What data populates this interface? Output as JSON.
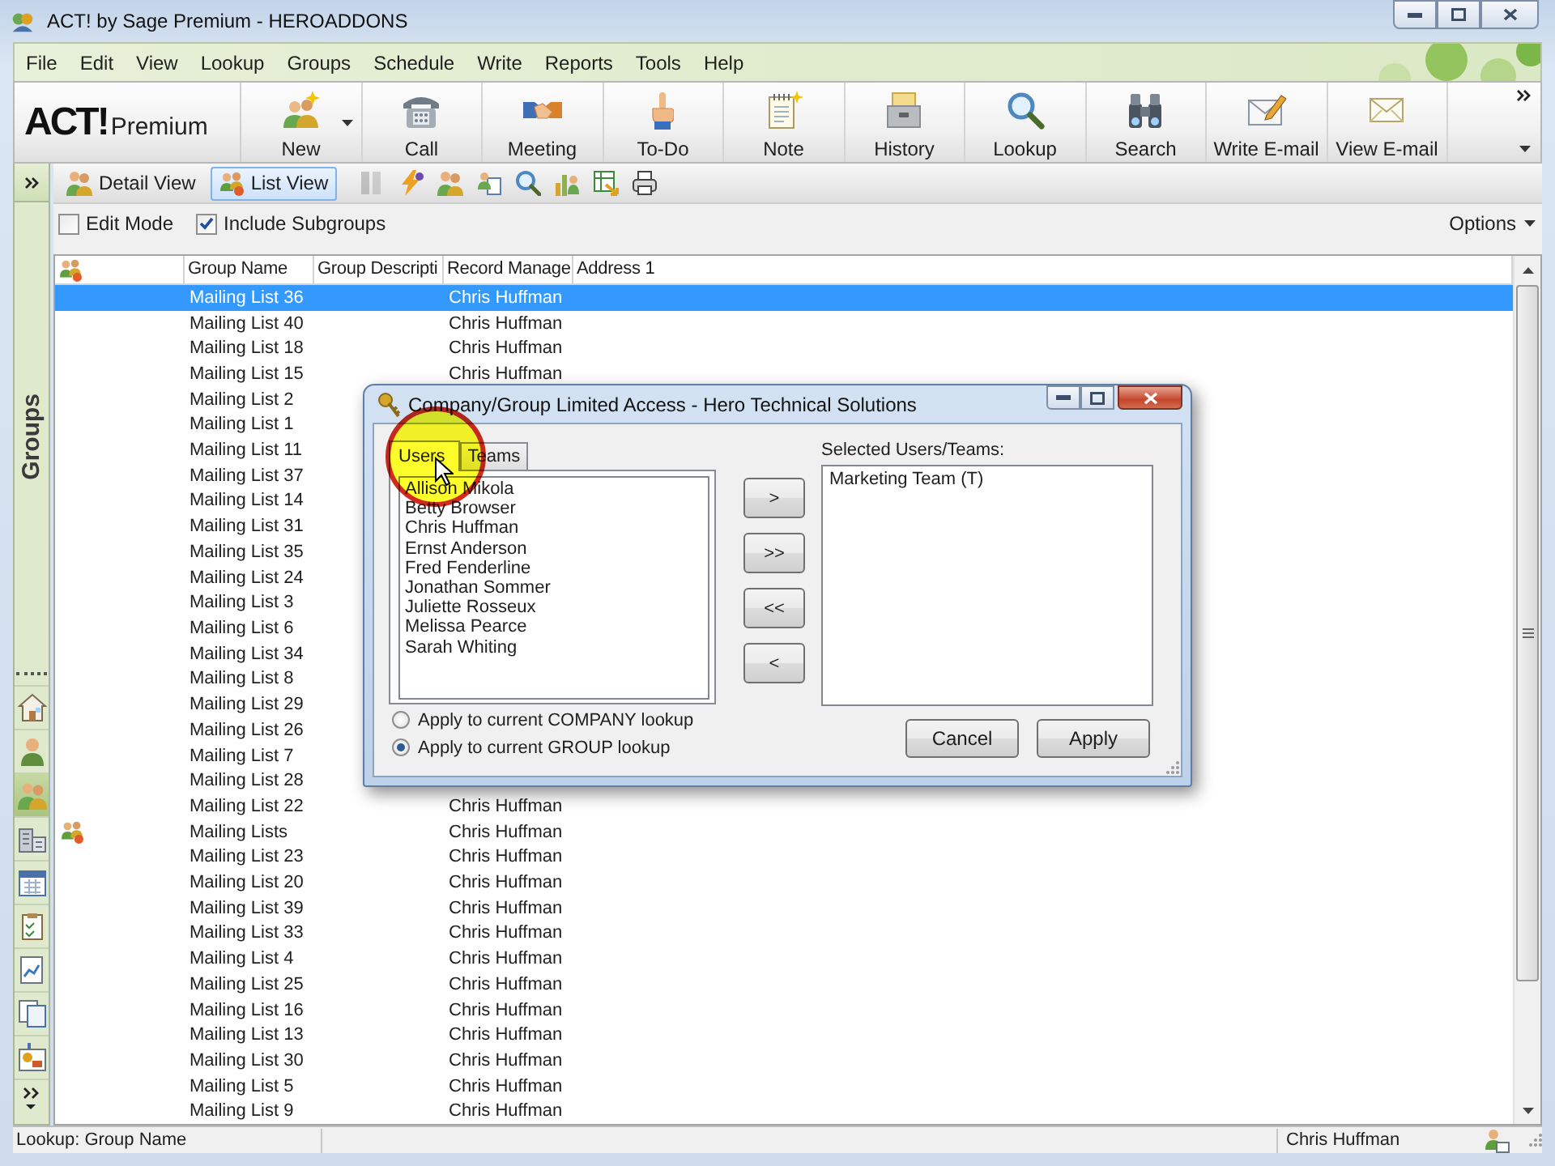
{
  "window": {
    "title": "ACT! by Sage Premium - HEROADDONS"
  },
  "menu": [
    "File",
    "Edit",
    "View",
    "Lookup",
    "Groups",
    "Schedule",
    "Write",
    "Reports",
    "Tools",
    "Help"
  ],
  "toolbar": {
    "logo": {
      "brand": "ACT!",
      "edition": "Premium"
    },
    "buttons": [
      {
        "label": "New",
        "dropdown": true
      },
      {
        "label": "Call",
        "dropdown": false
      },
      {
        "label": "Meeting",
        "dropdown": false
      },
      {
        "label": "To-Do",
        "dropdown": false
      },
      {
        "label": "Note",
        "dropdown": false
      },
      {
        "label": "History",
        "dropdown": false
      },
      {
        "label": "Lookup",
        "dropdown": false
      },
      {
        "label": "Search",
        "dropdown": false
      },
      {
        "label": "Write E-mail",
        "dropdown": false
      },
      {
        "label": "View E-mail",
        "dropdown": false
      }
    ]
  },
  "view_toolbar": {
    "views": [
      {
        "label": "Detail View",
        "selected": false
      },
      {
        "label": "List View",
        "selected": true
      }
    ],
    "tools": [
      {
        "disabled": true
      },
      {
        "disabled": false
      },
      {
        "disabled": false
      },
      {
        "disabled": false
      },
      {
        "disabled": false
      },
      {
        "disabled": false
      },
      {
        "disabled": false
      },
      {
        "disabled": false
      }
    ]
  },
  "options_bar": {
    "checkboxes": [
      {
        "label": "Edit Mode",
        "checked": false
      },
      {
        "label": "Include Subgroups",
        "checked": true
      }
    ],
    "options": "Options"
  },
  "sidebar": {
    "title": "Groups",
    "items": [
      {
        "selected": false
      },
      {
        "selected": false
      },
      {
        "selected": true
      },
      {
        "selected": false
      },
      {
        "selected": false
      },
      {
        "selected": false
      },
      {
        "selected": false
      },
      {
        "selected": false
      },
      {
        "selected": false
      }
    ]
  },
  "table": {
    "columns": [
      "Group Name",
      "Group Descripti",
      "Record Manage",
      "Address 1"
    ],
    "rows": [
      {
        "group_name": "Mailing List 36",
        "record_manager": "Chris Huffman",
        "kind": "list",
        "selected": true
      },
      {
        "group_name": "Mailing List 40",
        "record_manager": "Chris Huffman",
        "kind": "list",
        "selected": false
      },
      {
        "group_name": "Mailing List 18",
        "record_manager": "Chris Huffman",
        "kind": "list",
        "selected": false
      },
      {
        "group_name": "Mailing List 15",
        "record_manager": "Chris Huffman",
        "kind": "list",
        "selected": false
      },
      {
        "group_name": "Mailing List 2",
        "kind": "list",
        "selected": false
      },
      {
        "group_name": "Mailing List 1",
        "kind": "list",
        "selected": false
      },
      {
        "group_name": "Mailing List 11",
        "kind": "list",
        "selected": false
      },
      {
        "group_name": "Mailing List 37",
        "kind": "list",
        "selected": false
      },
      {
        "group_name": "Mailing List 14",
        "kind": "list",
        "selected": false
      },
      {
        "group_name": "Mailing List 31",
        "kind": "list",
        "selected": false
      },
      {
        "group_name": "Mailing List 35",
        "kind": "list",
        "selected": false
      },
      {
        "group_name": "Mailing List 24",
        "kind": "list",
        "selected": false
      },
      {
        "group_name": "Mailing List 3",
        "kind": "list",
        "selected": false
      },
      {
        "group_name": "Mailing List 6",
        "kind": "list",
        "selected": false
      },
      {
        "group_name": "Mailing List 34",
        "kind": "list",
        "selected": false
      },
      {
        "group_name": "Mailing List 8",
        "kind": "list",
        "selected": false
      },
      {
        "group_name": "Mailing List 29",
        "kind": "list",
        "selected": false
      },
      {
        "group_name": "Mailing List 26",
        "kind": "list",
        "selected": false
      },
      {
        "group_name": "Mailing List 7",
        "kind": "list",
        "selected": false
      },
      {
        "group_name": "Mailing List 28",
        "kind": "list",
        "selected": false
      },
      {
        "group_name": "Mailing List 22",
        "record_manager": "Chris Huffman",
        "kind": "list",
        "selected": false
      },
      {
        "group_name": "Mailing Lists",
        "record_manager": "Chris Huffman",
        "kind": "parent",
        "selected": false
      },
      {
        "group_name": "Mailing List 23",
        "record_manager": "Chris Huffman",
        "kind": "list",
        "selected": false
      },
      {
        "group_name": "Mailing List 20",
        "record_manager": "Chris Huffman",
        "kind": "list",
        "selected": false
      },
      {
        "group_name": "Mailing List 39",
        "record_manager": "Chris Huffman",
        "kind": "list",
        "selected": false
      },
      {
        "group_name": "Mailing List 33",
        "record_manager": "Chris Huffman",
        "kind": "list",
        "selected": false
      },
      {
        "group_name": "Mailing List 4",
        "record_manager": "Chris Huffman",
        "kind": "list",
        "selected": false
      },
      {
        "group_name": "Mailing List 25",
        "record_manager": "Chris Huffman",
        "kind": "list",
        "selected": false
      },
      {
        "group_name": "Mailing List 16",
        "record_manager": "Chris Huffman",
        "kind": "list",
        "selected": false
      },
      {
        "group_name": "Mailing List 13",
        "record_manager": "Chris Huffman",
        "kind": "list",
        "selected": false
      },
      {
        "group_name": "Mailing List 30",
        "record_manager": "Chris Huffman",
        "kind": "list",
        "selected": false
      },
      {
        "group_name": "Mailing List 5",
        "record_manager": "Chris Huffman",
        "kind": "list",
        "selected": false
      },
      {
        "group_name": "Mailing List 9",
        "record_manager": "Chris Huffman",
        "kind": "list",
        "selected": false
      }
    ]
  },
  "dialog": {
    "title": "Company/Group Limited Access - Hero Technical Solutions",
    "tabs": [
      {
        "label": "Users",
        "selected": true
      },
      {
        "label": "Teams",
        "selected": false
      }
    ],
    "users": [
      "Allison Mikola",
      "Betty Browser",
      "Chris Huffman",
      "Ernst Anderson",
      "Fred Fenderline",
      "Jonathan Sommer",
      "Juliette Rosseux",
      "Melissa Pearce",
      "Sarah Whiting"
    ],
    "move_buttons": [
      ">",
      ">>",
      "<<",
      "<"
    ],
    "selected_label": "Selected Users/Teams:",
    "selected_items": [
      "Marketing Team (T)"
    ],
    "scopes": [
      {
        "label": "Apply to current COMPANY lookup",
        "selected": false
      },
      {
        "label": "Apply to current GROUP lookup",
        "selected": true
      }
    ],
    "buttons": [
      "Cancel",
      "Apply"
    ]
  },
  "status_bar": {
    "lookup": "Lookup: Group Name",
    "user": "Chris Huffman"
  }
}
